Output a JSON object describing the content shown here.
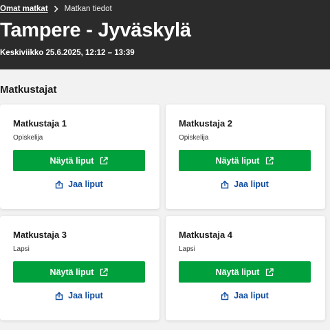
{
  "breadcrumb": {
    "home": "Omat matkat",
    "current": "Matkan tiedot"
  },
  "header": {
    "title": "Tampere - Jyväskylä",
    "time": "Keskiviikko 25.6.2025, 12:12 – 13:39"
  },
  "section": {
    "title": "Matkustajat"
  },
  "passengers": [
    {
      "name": "Matkustaja 1",
      "type": "Opiskelija",
      "show_label": "Näytä liput",
      "share_label": "Jaa liput"
    },
    {
      "name": "Matkustaja 2",
      "type": "Opiskelija",
      "show_label": "Näytä liput",
      "share_label": "Jaa liput"
    },
    {
      "name": "Matkustaja 3",
      "type": "Lapsi",
      "show_label": "Näytä liput",
      "share_label": "Jaa liput"
    },
    {
      "name": "Matkustaja 4",
      "type": "Lapsi",
      "show_label": "Näytä liput",
      "share_label": "Jaa liput"
    }
  ],
  "icons": {
    "breadcrumb_separator": "chevron-right-icon",
    "show_tickets": "external-link-icon",
    "share_tickets": "share-icon"
  },
  "colors": {
    "header_bg": "#2b2b2b",
    "primary_button": "#00a03c",
    "link": "#0f4c9e",
    "page_bg": "#f2f2f2"
  }
}
